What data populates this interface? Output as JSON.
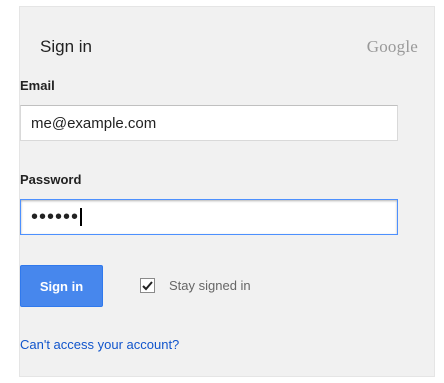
{
  "form": {
    "title": "Sign in",
    "brand": "Google",
    "email_label": "Email",
    "email_value": "me@example.com",
    "password_label": "Password",
    "password_mask": "••••••",
    "signin_label": "Sign in",
    "stay_signed_in_label": "Stay signed in",
    "stay_signed_in_checked": true,
    "cant_access_link": "Can't access your account?"
  },
  "colors": {
    "card_background": "#f1f1f1",
    "button_blue": "#4787ed",
    "focus_border": "#4d90fe",
    "link_blue": "#1155cc"
  },
  "icons": {
    "checkbox": "checkmark-icon"
  }
}
